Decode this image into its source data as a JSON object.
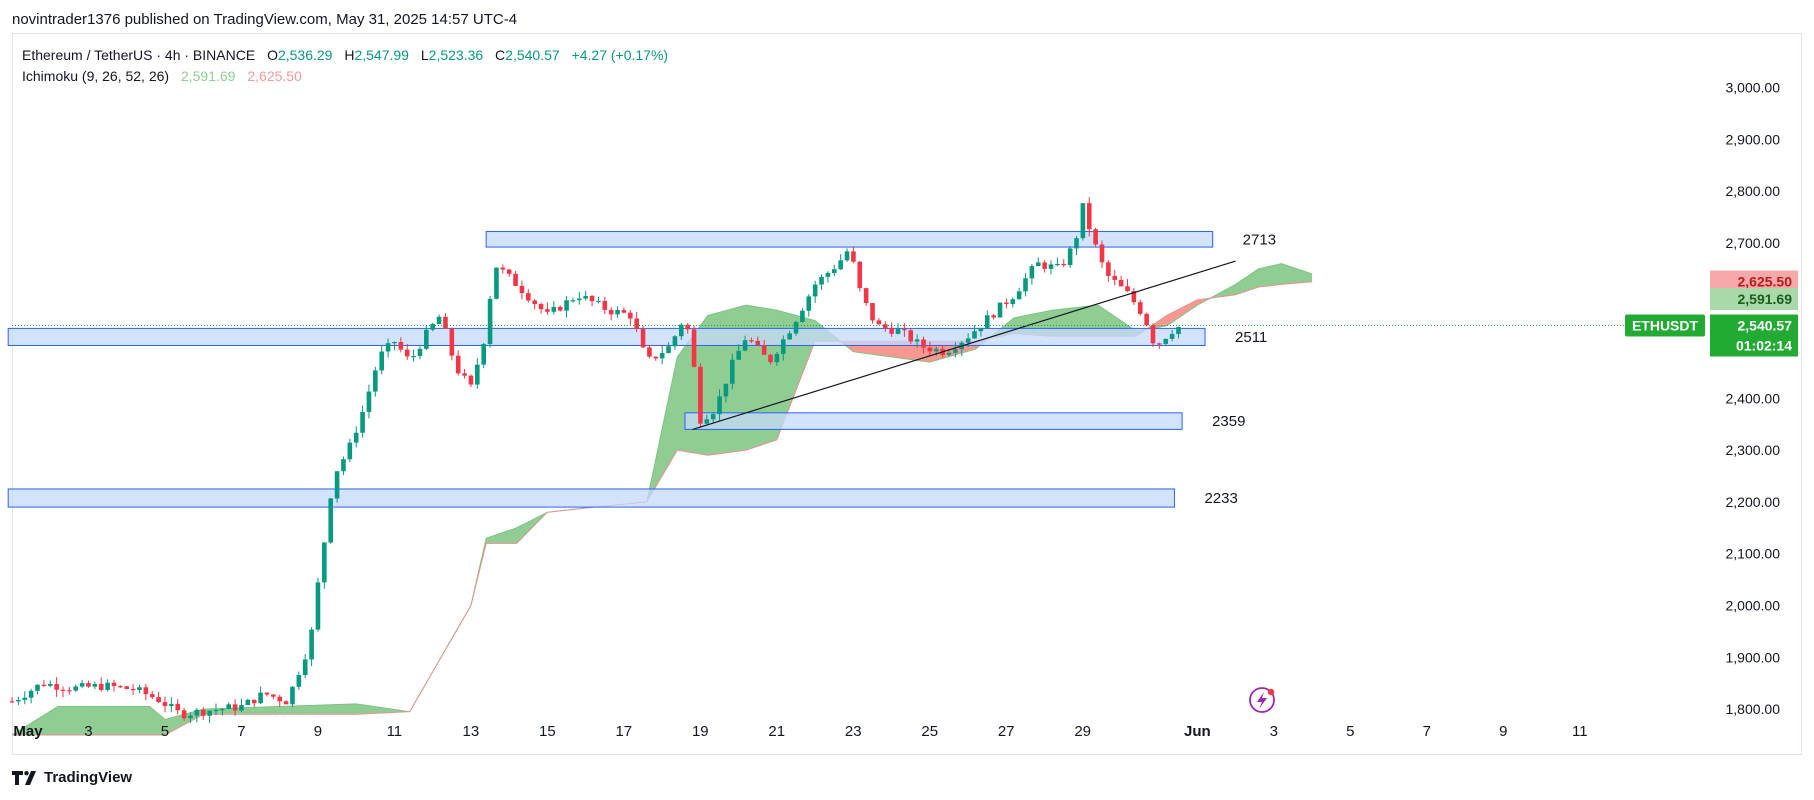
{
  "header": {
    "publisher": "novintrader1376 published on TradingView.com, May 31, 2025 14:57 UTC-4"
  },
  "legend": {
    "symbol": "Ethereum / TetherUS · 4h · BINANCE",
    "o_label": "O",
    "o": "2,536.29",
    "h_label": "H",
    "h": "2,547.99",
    "l_label": "L",
    "l": "2,523.36",
    "c_label": "C",
    "c": "2,540.57",
    "change": "+4.27 (+0.17%)",
    "indicator": "Ichimoku (9, 26, 52, 26)",
    "ind_val1": "2,591.69",
    "ind_val2": "2,625.50"
  },
  "footer": {
    "brand": "TradingView"
  },
  "colors": {
    "up": "#089981",
    "down": "#f23645",
    "cloud_bull": "#4caf50",
    "cloud_bear": "#f44336",
    "zone_fill": "#c6d9fb",
    "zone_stroke": "#2962ff",
    "price_tag": "#22ab33"
  },
  "chart_data": {
    "type": "candlestick",
    "symbol": "ETHUSDT",
    "timeframe": "4h",
    "y_axis": {
      "min": 1750,
      "max": 3030,
      "ticks": [
        1800,
        1900,
        2000,
        2100,
        2200,
        2300,
        2400,
        2700,
        2800,
        2900,
        3000
      ],
      "tick_labels": [
        "1,800.00",
        "1,900.00",
        "2,000.00",
        "2,100.00",
        "2,200.00",
        "2,300.00",
        "2,400.00",
        "2,700.00",
        "2,800.00",
        "2,900.00",
        "3,000.00"
      ]
    },
    "x_axis": {
      "labels": [
        {
          "text": "May",
          "bold": true,
          "day": 1
        },
        {
          "text": "3",
          "day": 3
        },
        {
          "text": "5",
          "day": 5
        },
        {
          "text": "7",
          "day": 7
        },
        {
          "text": "9",
          "day": 9
        },
        {
          "text": "11",
          "day": 11
        },
        {
          "text": "13",
          "day": 13
        },
        {
          "text": "15",
          "day": 15
        },
        {
          "text": "17",
          "day": 17
        },
        {
          "text": "19",
          "day": 19
        },
        {
          "text": "21",
          "day": 21
        },
        {
          "text": "23",
          "day": 23
        },
        {
          "text": "25",
          "day": 25
        },
        {
          "text": "27",
          "day": 27
        },
        {
          "text": "29",
          "day": 29
        },
        {
          "text": "Jun",
          "bold": true,
          "day": 32
        },
        {
          "text": "3",
          "day": 34
        },
        {
          "text": "5",
          "day": 36
        },
        {
          "text": "7",
          "day": 38
        },
        {
          "text": "9",
          "day": 40
        },
        {
          "text": "11",
          "day": 42
        }
      ]
    },
    "candles_anchor": [
      [
        1.0,
        1815
      ],
      [
        1.8,
        1850
      ],
      [
        2.6,
        1840
      ],
      [
        3.4,
        1845
      ],
      [
        4.2,
        1838
      ],
      [
        4.8,
        1820
      ],
      [
        5.4,
        1790
      ],
      [
        6.2,
        1798
      ],
      [
        7.0,
        1805
      ],
      [
        7.6,
        1830
      ],
      [
        8.2,
        1815
      ],
      [
        8.8,
        1930
      ],
      [
        9.0,
        2040
      ],
      [
        9.2,
        2140
      ],
      [
        9.4,
        2250
      ],
      [
        9.8,
        2300
      ],
      [
        10.2,
        2380
      ],
      [
        10.6,
        2480
      ],
      [
        11.0,
        2510
      ],
      [
        11.4,
        2470
      ],
      [
        11.8,
        2520
      ],
      [
        12.2,
        2560
      ],
      [
        12.6,
        2460
      ],
      [
        13.0,
        2420
      ],
      [
        13.4,
        2530
      ],
      [
        13.6,
        2660
      ],
      [
        14.2,
        2620
      ],
      [
        15.0,
        2560
      ],
      [
        15.8,
        2600
      ],
      [
        16.6,
        2570
      ],
      [
        17.2,
        2560
      ],
      [
        17.6,
        2470
      ],
      [
        18.2,
        2500
      ],
      [
        18.6,
        2560
      ],
      [
        18.8,
        2480
      ],
      [
        19.0,
        2360
      ],
      [
        19.4,
        2380
      ],
      [
        19.8,
        2460
      ],
      [
        20.2,
        2520
      ],
      [
        20.8,
        2470
      ],
      [
        21.4,
        2540
      ],
      [
        22.0,
        2620
      ],
      [
        22.6,
        2660
      ],
      [
        22.9,
        2690
      ],
      [
        23.2,
        2600
      ],
      [
        23.6,
        2540
      ],
      [
        24.2,
        2530
      ],
      [
        24.8,
        2500
      ],
      [
        25.4,
        2490
      ],
      [
        26.0,
        2520
      ],
      [
        26.6,
        2560
      ],
      [
        27.2,
        2600
      ],
      [
        27.8,
        2660
      ],
      [
        28.4,
        2650
      ],
      [
        28.8,
        2700
      ],
      [
        29.0,
        2770
      ],
      [
        29.3,
        2700
      ],
      [
        29.6,
        2640
      ],
      [
        30.2,
        2600
      ],
      [
        30.6,
        2560
      ],
      [
        30.9,
        2500
      ],
      [
        31.3,
        2530
      ],
      [
        31.6,
        2541
      ]
    ],
    "candles_last_day": 31.6,
    "cloud": {
      "span_a": [
        [
          1,
          1750
        ],
        [
          2.2,
          1805
        ],
        [
          4.6,
          1805
        ],
        [
          5.0,
          1780
        ],
        [
          6.0,
          1800
        ],
        [
          8.0,
          1805
        ],
        [
          10.0,
          1810
        ],
        [
          11.4,
          1795
        ],
        [
          13.0,
          2000
        ],
        [
          13.4,
          2130
        ],
        [
          14.2,
          2150
        ],
        [
          15.0,
          2180
        ],
        [
          16.2,
          2190
        ],
        [
          17.6,
          2200
        ],
        [
          18.4,
          2480
        ],
        [
          19.2,
          2560
        ],
        [
          20.2,
          2580
        ],
        [
          21.0,
          2570
        ],
        [
          22.0,
          2550
        ],
        [
          23.0,
          2490
        ],
        [
          24.0,
          2480
        ],
        [
          25.0,
          2470
        ],
        [
          26.2,
          2495
        ],
        [
          27.2,
          2555
        ],
        [
          28.2,
          2570
        ],
        [
          29.4,
          2580
        ],
        [
          30.4,
          2530
        ],
        [
          31.2,
          2540
        ],
        [
          32.0,
          2580
        ],
        [
          33.0,
          2620
        ],
        [
          33.6,
          2650
        ],
        [
          34.2,
          2660
        ],
        [
          35.0,
          2640
        ]
      ],
      "span_b": [
        [
          1,
          1750
        ],
        [
          2.2,
          1750
        ],
        [
          4.6,
          1750
        ],
        [
          5.0,
          1750
        ],
        [
          6.0,
          1790
        ],
        [
          8.0,
          1790
        ],
        [
          10.0,
          1790
        ],
        [
          11.4,
          1795
        ],
        [
          13.0,
          2000
        ],
        [
          13.4,
          2120
        ],
        [
          14.2,
          2120
        ],
        [
          15.0,
          2180
        ],
        [
          16.2,
          2190
        ],
        [
          17.6,
          2200
        ],
        [
          18.4,
          2300
        ],
        [
          19.2,
          2290
        ],
        [
          20.2,
          2300
        ],
        [
          21.0,
          2320
        ],
        [
          22.0,
          2510
        ],
        [
          23.0,
          2510
        ],
        [
          24.0,
          2510
        ],
        [
          25.0,
          2510
        ],
        [
          26.2,
          2510
        ],
        [
          27.2,
          2525
        ],
        [
          28.2,
          2520
        ],
        [
          29.4,
          2520
        ],
        [
          30.4,
          2520
        ],
        [
          31.2,
          2560
        ],
        [
          32.0,
          2590
        ],
        [
          33.0,
          2600
        ],
        [
          33.6,
          2615
        ],
        [
          34.2,
          2620
        ],
        [
          35.0,
          2625
        ]
      ]
    },
    "zones": [
      {
        "label": "2713",
        "low": 2692,
        "high": 2722,
        "start_day": 13.4,
        "end_day": 32.4
      },
      {
        "label": "2511",
        "low": 2502,
        "high": 2535,
        "start_day": 0.9,
        "end_day": 32.2
      },
      {
        "label": "2359",
        "low": 2340,
        "high": 2372,
        "start_day": 18.6,
        "end_day": 31.6
      },
      {
        "label": "2233",
        "low": 2190,
        "high": 2225,
        "start_day": 0.9,
        "end_day": 31.4
      }
    ],
    "trendline": {
      "from": [
        18.8,
        2340
      ],
      "to": [
        33.0,
        2665
      ]
    },
    "price_labels": {
      "symbol": "ETHUSDT",
      "last": "2,540.57",
      "countdown": "01:02:14",
      "span_b_value": "2,625.50",
      "span_a_value": "2,591.69",
      "last_value": 2540.57
    }
  }
}
